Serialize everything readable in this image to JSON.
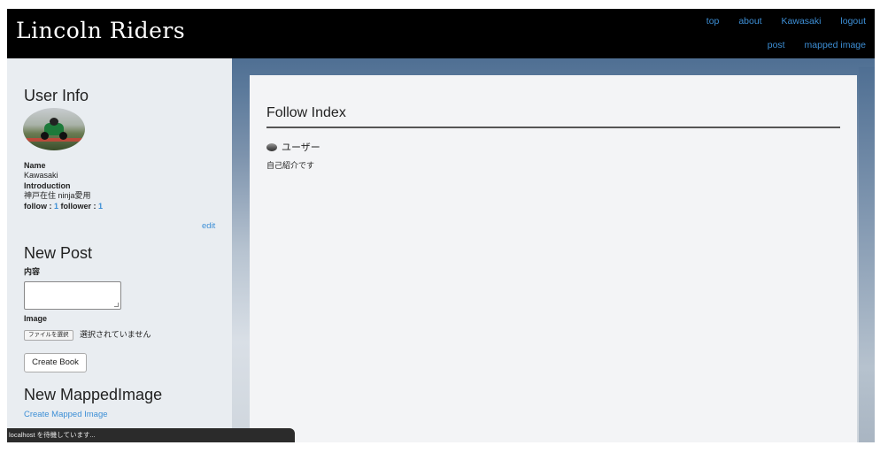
{
  "header": {
    "brand": "Lincoln Riders",
    "nav_row1": [
      "top",
      "about",
      "Kawasaki",
      "logout"
    ],
    "nav_row2": [
      "post",
      "mapped image"
    ]
  },
  "sidebar": {
    "user_info_heading": "User Info",
    "name_label": "Name",
    "name_value": "Kawasaki",
    "intro_label": "Introduction",
    "intro_value": "神戸在住 ninja愛用",
    "follow_label": "follow : ",
    "follow_count": "1",
    "follower_label": " follower : ",
    "follower_count": "1",
    "edit_link": "edit",
    "new_post_heading": "New Post",
    "content_label": "内容",
    "image_label": "Image",
    "file_button": "ファイルを選択",
    "file_status": "選択されていません",
    "create_button": "Create Book",
    "mapped_heading": "New MappedImage",
    "mapped_link": "Create Mapped Image"
  },
  "main": {
    "title": "Follow Index",
    "user_name": "ユーザー",
    "user_intro": "自己紹介です"
  },
  "status_bar": {
    "text": "localhost を待機しています..."
  }
}
